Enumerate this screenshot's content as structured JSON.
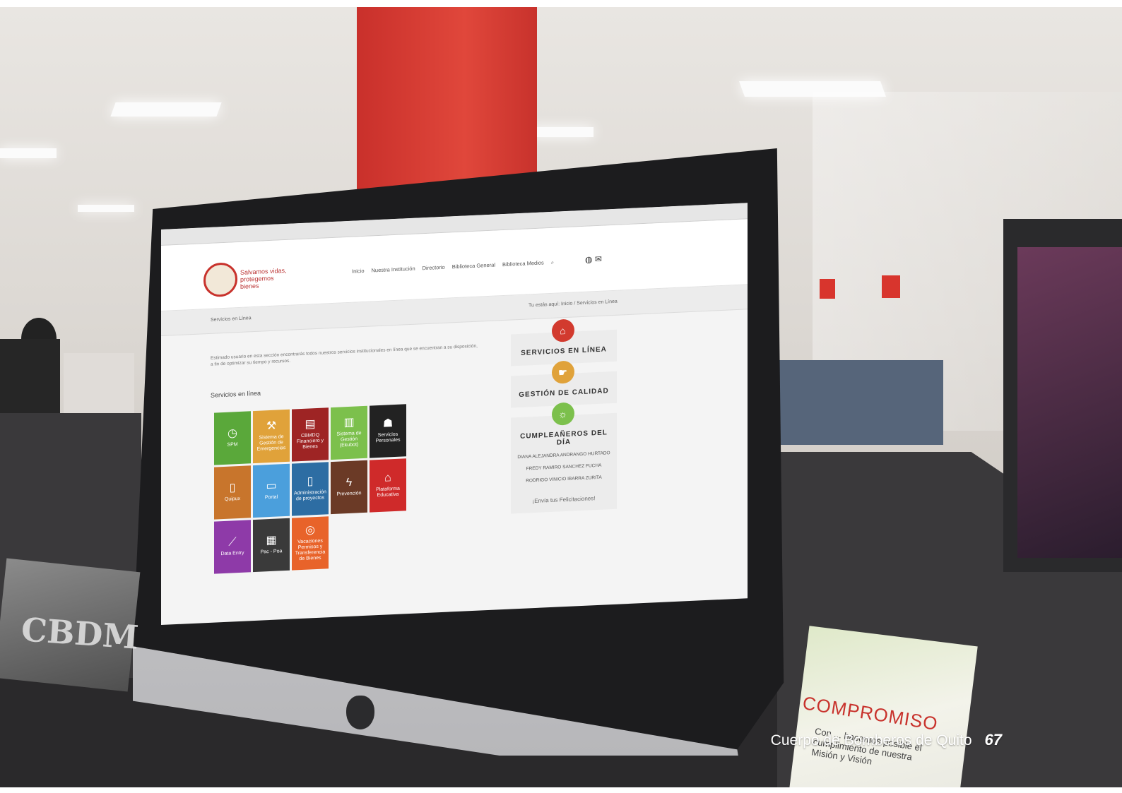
{
  "caption": {
    "publisher": "Cuerpo de Bomberos de Quito",
    "page_number": "67"
  },
  "website": {
    "tagline": "Salvamos vidas, protegemos bienes",
    "nav": [
      "Inicio",
      "Nuestra Institución",
      "Directorio",
      "Biblioteca General",
      "Biblioteca Medios"
    ],
    "page_title": "Servicios en Línea",
    "breadcrumb": "Tu estás aquí: Inicio / Servicios en Línea",
    "intro": "Estimado usuario en esta sección encontrarás todos nuestros servicios institucionales en línea que se encuentran a su disposición, a fin de optimizar su tiempo y recursos.",
    "section_title": "Servicios en línea",
    "tiles": [
      {
        "label": "SPM",
        "icon": "◷",
        "color": "#5aa83a"
      },
      {
        "label": "Sistema de Gestión de Emergencias",
        "icon": "⚒",
        "color": "#e0a23a"
      },
      {
        "label": "CBMDQ Financiero y Bienes",
        "icon": "▤",
        "color": "#9e2424"
      },
      {
        "label": "Sistema de Gestión (Ekubot)",
        "icon": "▥",
        "color": "#7cc04c"
      },
      {
        "label": "Servicios Personales",
        "icon": "☗",
        "color": "#222222"
      },
      {
        "label": "",
        "icon": "",
        "color": "transparent"
      },
      {
        "label": "Quipux",
        "icon": "▯",
        "color": "#c8752c"
      },
      {
        "label": "Portal",
        "icon": "▭",
        "color": "#4b9fdc"
      },
      {
        "label": "Administración de proyectos",
        "icon": "▯",
        "color": "#2d6da3"
      },
      {
        "label": "Prevención",
        "icon": "ϟ",
        "color": "#6b3a26"
      },
      {
        "label": "Plataforma Educativa",
        "icon": "⌂",
        "color": "#cf2a2a"
      },
      {
        "label": "",
        "icon": "",
        "color": "transparent"
      },
      {
        "label": "Data Entry",
        "icon": "⟋",
        "color": "#8e3aa8"
      },
      {
        "label": "Pac - Poa",
        "icon": "▦",
        "color": "#3a3a3a"
      },
      {
        "label": "Vacaciones Permisos y Transferencia de Bienes",
        "icon": "◎",
        "color": "#e8632a"
      }
    ],
    "sidebar": [
      {
        "title": "SERVICIOS EN LÍNEA",
        "icon": "⌂",
        "color": "#d23a2e"
      },
      {
        "title": "GESTIÓN DE CALIDAD",
        "icon": "☛",
        "color": "#e0a23a"
      },
      {
        "title": "CUMPLEAÑEROS DEL DÍA",
        "icon": "☼",
        "color": "#7cc04c"
      }
    ],
    "birthdays": [
      "DIANA ALEJANDRA ANDRANGO HURTADO",
      "FREDY RAMIRO SANCHEZ FUCHA",
      "RODRIGO VINICIO IBARRA ZURITA"
    ],
    "congrats": "¡Envía tus Felicitaciones!"
  },
  "desk_items": {
    "calendar_text": "CBDM",
    "card_title": "COMPROMISO",
    "card_text": "Con ... hacemos posible el cumplimiento de nuestra Misión y Visión"
  }
}
